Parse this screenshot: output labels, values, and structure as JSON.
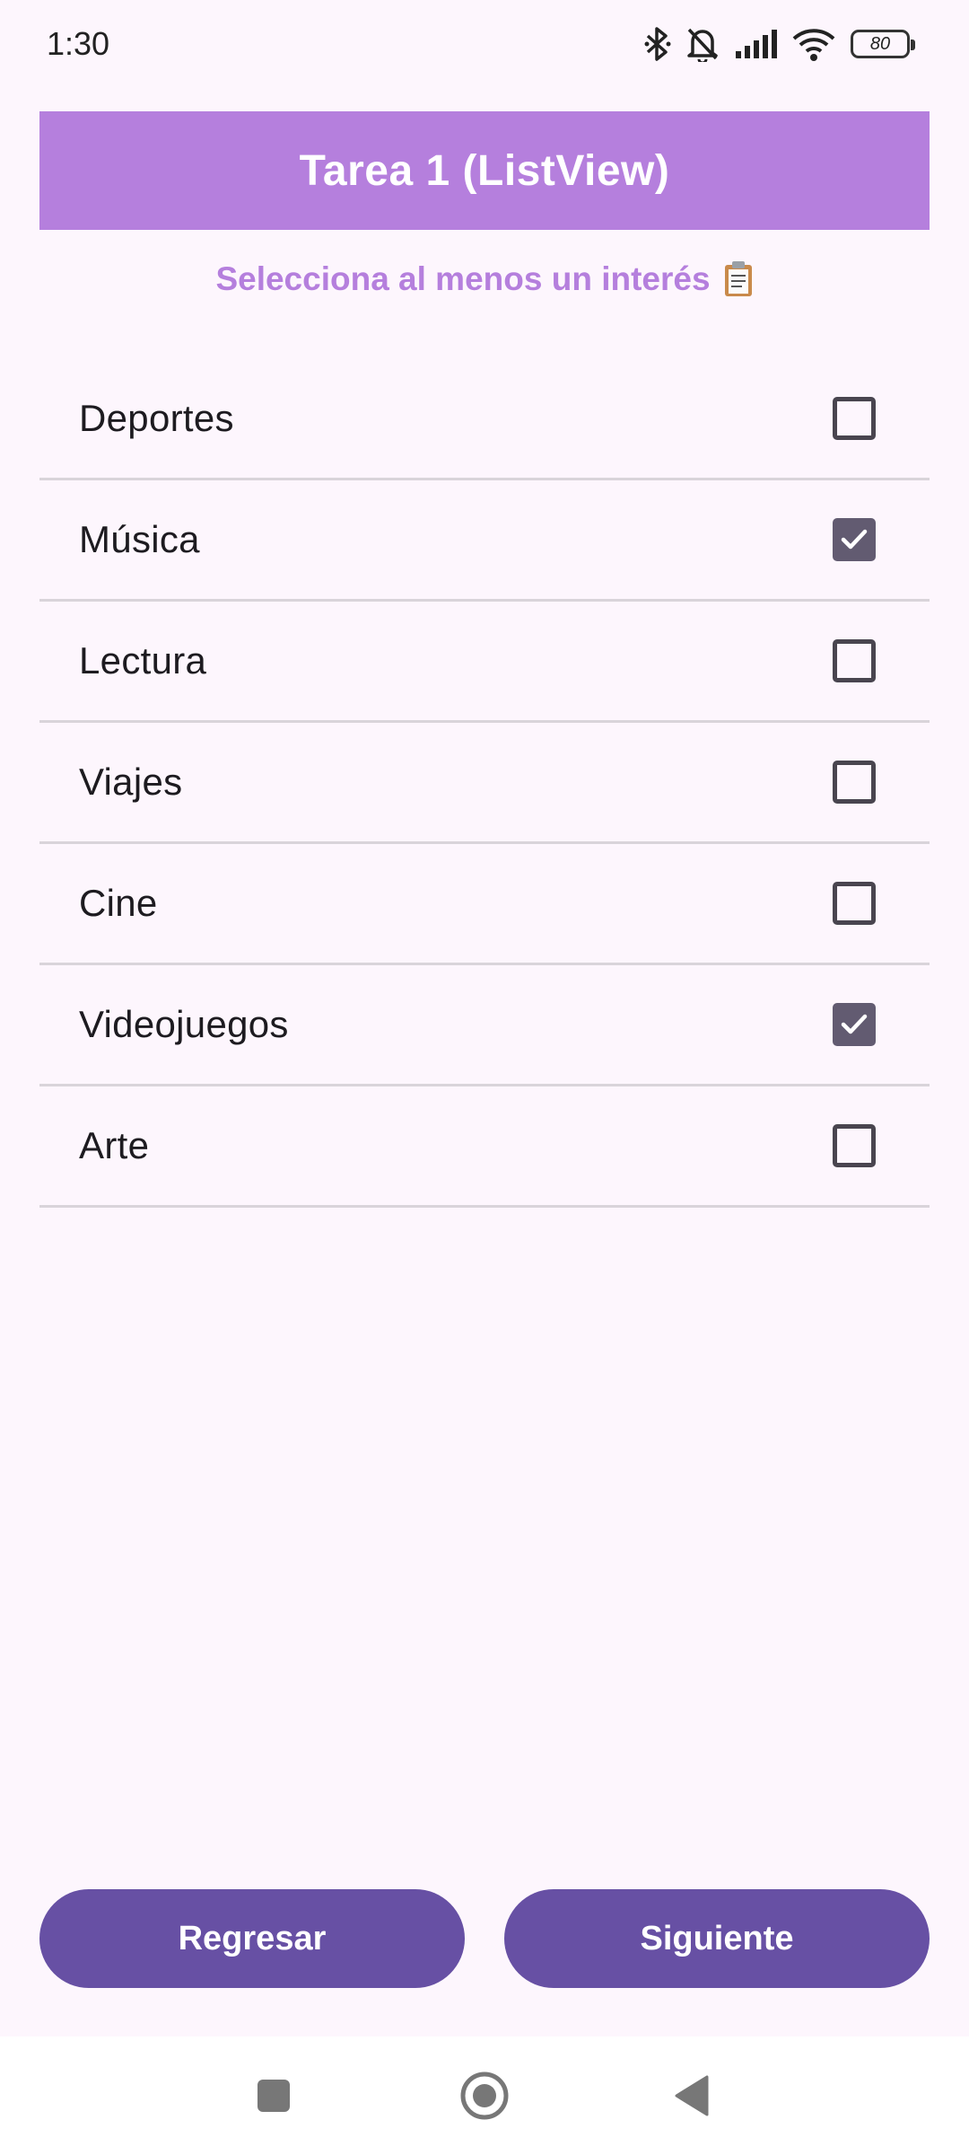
{
  "status_bar": {
    "time": "1:30",
    "battery": "80",
    "icons": [
      "bluetooth-icon",
      "bell-off-icon",
      "signal-icon",
      "wifi-icon",
      "battery-icon"
    ]
  },
  "header": {
    "title": "Tarea 1 (ListView)"
  },
  "subtitle": {
    "text": "Selecciona al menos un interés",
    "icon": "clipboard-icon"
  },
  "interests": [
    {
      "label": "Deportes",
      "checked": false
    },
    {
      "label": "Música",
      "checked": true
    },
    {
      "label": "Lectura",
      "checked": false
    },
    {
      "label": "Viajes",
      "checked": false
    },
    {
      "label": "Cine",
      "checked": false
    },
    {
      "label": "Videojuegos",
      "checked": true
    },
    {
      "label": "Arte",
      "checked": false
    }
  ],
  "buttons": {
    "back_label": "Regresar",
    "next_label": "Siguiente"
  },
  "navigation": {
    "icons": [
      "recents-icon",
      "home-icon",
      "back-icon"
    ]
  },
  "colors": {
    "header_bg": "#b57fdd",
    "subtitle": "#b57fdd",
    "button_bg": "#6750a4",
    "checkbox_checked": "#625b71",
    "background": "#fdf6fd"
  }
}
